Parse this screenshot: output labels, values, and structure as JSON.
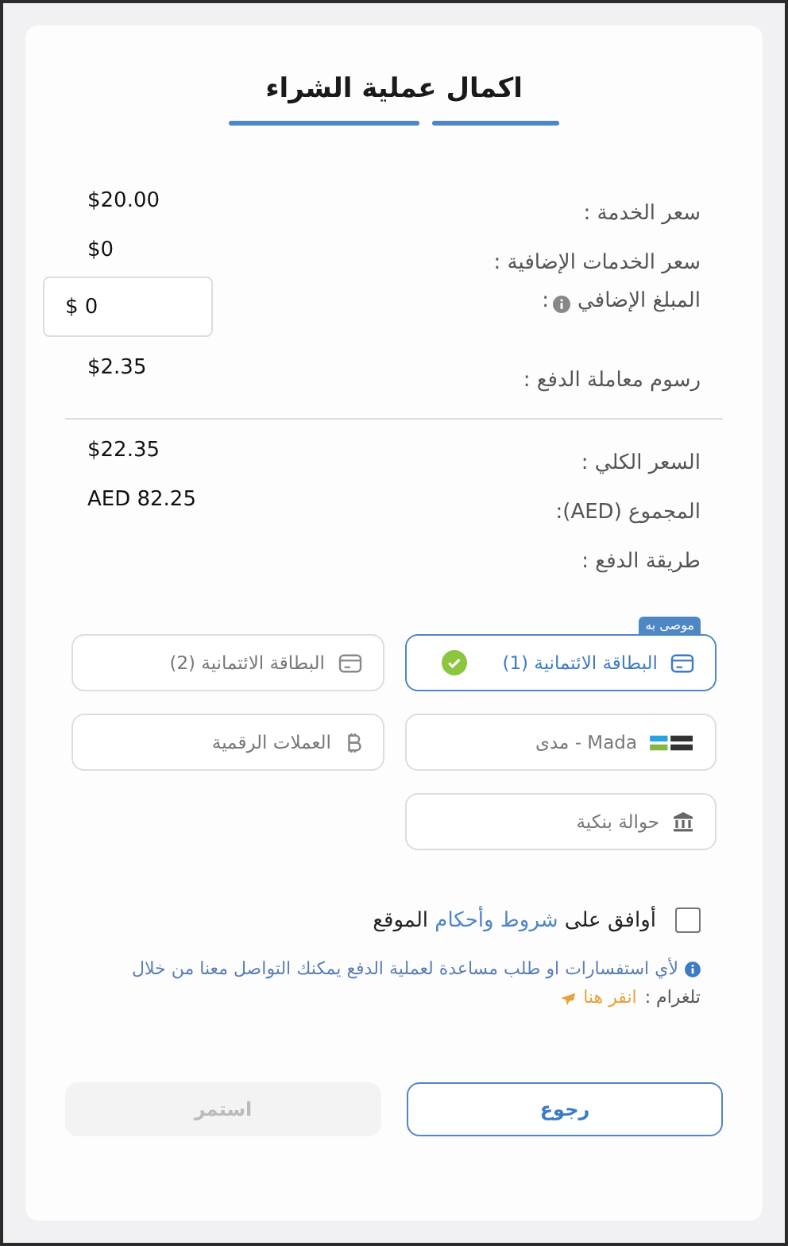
{
  "title": "اكمال عملية الشراء",
  "steps": [
    {
      "done": true
    },
    {
      "done": true
    }
  ],
  "charges": [
    {
      "kind": "text",
      "label": "سعر الخدمة :",
      "value": "$20.00"
    },
    {
      "kind": "text",
      "label": "سعر الخدمات الإضافية :",
      "value": "$0"
    },
    {
      "kind": "input",
      "label": "المبلغ الإضافي",
      "suffix": ":",
      "value": "$ 0"
    },
    {
      "kind": "text",
      "label": "رسوم معاملة الدفع :",
      "value": "$2.35"
    }
  ],
  "totals": [
    {
      "kind": "text",
      "label": "السعر الكلي :",
      "value": "$22.35"
    },
    {
      "kind": "text",
      "label": "المجموع (AED):",
      "value": "AED 82.25"
    },
    {
      "kind": "heading",
      "label": "طريقة الدفع :"
    }
  ],
  "payment_methods": [
    {
      "kind": "card",
      "label": "البطاقة الائتمانية (1)",
      "selected": true,
      "badge": "موصى به"
    },
    {
      "kind": "card",
      "label": "البطاقة الائتمانية (2)",
      "selected": false
    },
    {
      "kind": "mada",
      "label": "Mada - مدى",
      "selected": false
    },
    {
      "kind": "crypto",
      "label": "العملات الرقمية",
      "selected": false
    },
    {
      "kind": "bank",
      "label": "حوالة بنكية",
      "selected": false
    }
  ],
  "terms": {
    "checked": false,
    "before": "أوافق على",
    "link": "شروط وأحكام",
    "after": "الموقع"
  },
  "note": {
    "text": "لأي استفسارات او طلب مساعدة لعملية الدفع يمكنك التواصل معنا من خلال",
    "channel": "تلغرام :",
    "link": "انقر هنا"
  },
  "buttons": [
    {
      "label": "رجوع",
      "disabled": false
    },
    {
      "label": "استمر",
      "disabled": true
    }
  ]
}
